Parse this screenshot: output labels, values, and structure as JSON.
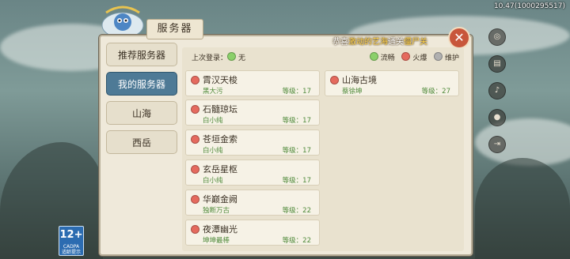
{
  "version": "10.47(1000295517)",
  "dialog": {
    "title": "服务器",
    "close_icon": "✕"
  },
  "announcement": {
    "prefix": "恭喜",
    "highlight1": "激动的艺海",
    "middle": "通关",
    "highlight2": "僵尸关"
  },
  "menu": [
    {
      "label": "推荐服务器",
      "active": false
    },
    {
      "label": "我的服务器",
      "active": true
    },
    {
      "label": "山海",
      "active": false
    },
    {
      "label": "西岳",
      "active": false
    }
  ],
  "last_login": {
    "label": "上次登录：",
    "value": "无"
  },
  "legend": [
    {
      "label": "流畅",
      "color": "#8bd06a"
    },
    {
      "label": "火爆",
      "color": "#e56a5e"
    },
    {
      "label": "维护",
      "color": "#b0b0b0"
    }
  ],
  "servers": [
    {
      "name": "霄汉天梭",
      "owner": "黑大污",
      "level": "等级：17",
      "status": "red"
    },
    {
      "name": "石髓琼坛",
      "owner": "白小纯",
      "level": "等级：17",
      "status": "red"
    },
    {
      "name": "苍垣金索",
      "owner": "白小纯",
      "level": "等级：17",
      "status": "red"
    },
    {
      "name": "玄岳星枢",
      "owner": "白小纯",
      "level": "等级：17",
      "status": "red"
    },
    {
      "name": "华巅金阙",
      "owner": "独断万古",
      "level": "等级：22",
      "status": "red"
    },
    {
      "name": "夜潭幽光",
      "owner": "坤坤最棒",
      "level": "等级：22",
      "status": "red"
    },
    {
      "name": "山海古境",
      "owner": "蔡徐坤",
      "level": "等级：27",
      "status": "red"
    }
  ],
  "rating": {
    "age": "12+",
    "sub": "CADPA",
    "caption": "适龄提示"
  },
  "side_icons": [
    "ring-icon",
    "ranking-icon",
    "sound-icon",
    "user-icon",
    "exit-icon"
  ]
}
